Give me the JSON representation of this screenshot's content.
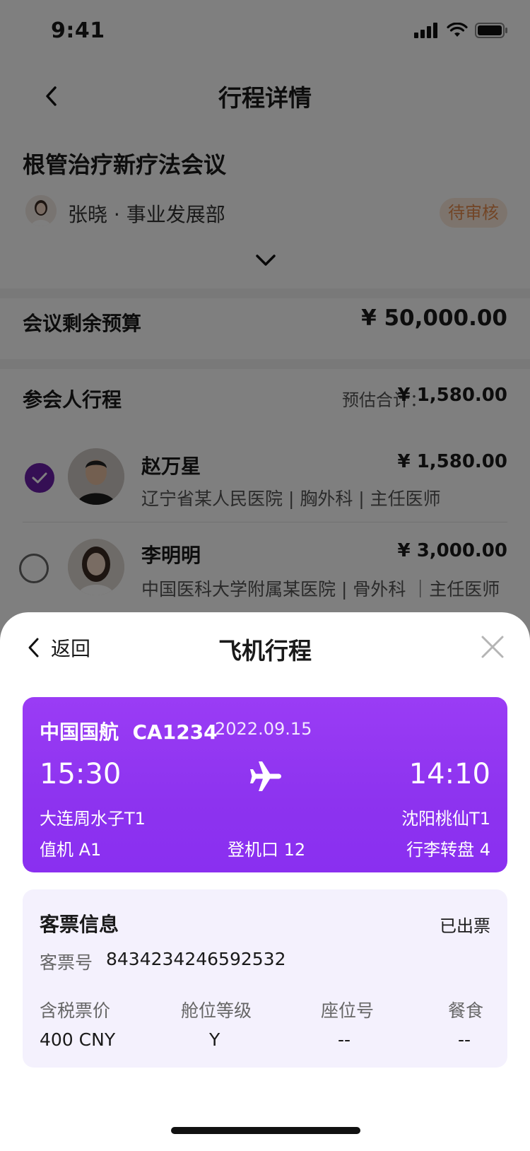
{
  "status_bar": {
    "time": "9:41"
  },
  "nav": {
    "title": "行程详情"
  },
  "meeting": {
    "title": "根管治疗新疗法会议",
    "organizer": "张晓",
    "department": "事业发展部",
    "status": "待审核"
  },
  "budget": {
    "label": "会议剩余预算",
    "value": "¥ 50,000.00"
  },
  "attendees": {
    "section_title": "参会人行程",
    "estimate_label": "预估合计：",
    "estimate_value": "¥ 1,580.00",
    "items": [
      {
        "name": "赵万星",
        "amount": "¥ 1,580.00",
        "info": "辽宁省某人民医院 | 胸外科 | 主任医师",
        "checked": true
      },
      {
        "name": "李明明",
        "amount": "¥ 3,000.00",
        "info": "中国医科大学附属某医院 | 骨外科 ｜主任医师",
        "checked": false
      }
    ]
  },
  "sheet": {
    "back_label": "返回",
    "title": "飞机行程"
  },
  "flight": {
    "airline_flight": "中国国航  CA1234",
    "date": "2022.09.15",
    "departure_time": "15:30",
    "arrival_time": "14:10",
    "departure_airport": "大连周水子T1",
    "arrival_airport": "沈阳桃仙T1",
    "checkin": "值机 A1",
    "gate": "登机口 12",
    "baggage": "行李转盘 4"
  },
  "ticket": {
    "title": "客票信息",
    "status": "已出票",
    "number_label": "客票号",
    "number_value": "8434234246592532",
    "columns": [
      {
        "label": "含税票价",
        "value": "400 CNY"
      },
      {
        "label": "舱位等级",
        "value": "Y"
      },
      {
        "label": "座位号",
        "value": "--"
      },
      {
        "label": "餐食",
        "value": "--"
      }
    ]
  },
  "colors": {
    "accent": "#8d33ef",
    "ticket_bg": "#f4f1fd",
    "pending_badge_text": "#e58b4c",
    "checkbox": "#6b1fa8"
  },
  "icons": {
    "status": [
      "signal-icon",
      "wifi-icon",
      "battery-icon"
    ],
    "back": "chevron-left-icon",
    "expand": "chevron-down-icon",
    "close": "close-icon",
    "plane": "airplane-icon",
    "check": "check-icon"
  }
}
